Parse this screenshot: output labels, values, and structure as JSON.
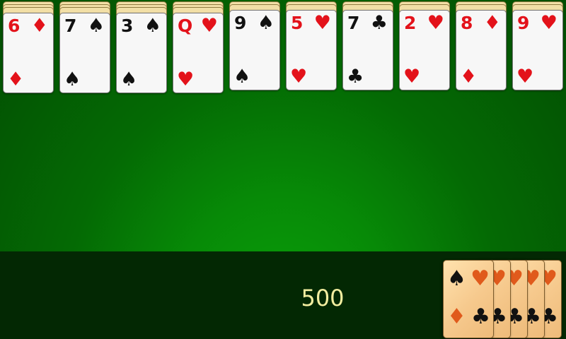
{
  "game": "spider-solitaire",
  "score": "500",
  "stock": {
    "remaining_deals": 5,
    "back_suits": [
      "spades",
      "hearts",
      "diamonds",
      "clubs"
    ]
  },
  "tableau": [
    {
      "rank": "6",
      "suit": "diamonds",
      "suit_symbol": "♦",
      "color": "red",
      "hidden_count": 3
    },
    {
      "rank": "7",
      "suit": "spades",
      "suit_symbol": "♠",
      "color": "black",
      "hidden_count": 3
    },
    {
      "rank": "3",
      "suit": "spades",
      "suit_symbol": "♠",
      "color": "black",
      "hidden_count": 3
    },
    {
      "rank": "Q",
      "suit": "hearts",
      "suit_symbol": "♥",
      "color": "red",
      "hidden_count": 3
    },
    {
      "rank": "9",
      "suit": "spades",
      "suit_symbol": "♠",
      "color": "black",
      "hidden_count": 2
    },
    {
      "rank": "5",
      "suit": "hearts",
      "suit_symbol": "♥",
      "color": "red",
      "hidden_count": 2
    },
    {
      "rank": "7",
      "suit": "clubs",
      "suit_symbol": "♣",
      "color": "black",
      "hidden_count": 2
    },
    {
      "rank": "2",
      "suit": "hearts",
      "suit_symbol": "♥",
      "color": "red",
      "hidden_count": 2
    },
    {
      "rank": "8",
      "suit": "diamonds",
      "suit_symbol": "♦",
      "color": "red",
      "hidden_count": 2
    },
    {
      "rank": "9",
      "suit": "hearts",
      "suit_symbol": "♥",
      "color": "red",
      "hidden_count": 2
    }
  ],
  "colors": {
    "felt": "#078a07",
    "bar": "#032803",
    "score_text": "#f3eea0",
    "card_face": "#f7f7f7",
    "card_back": "#f6c98d",
    "red_suit": "#e3121a",
    "black_suit": "#111111"
  }
}
